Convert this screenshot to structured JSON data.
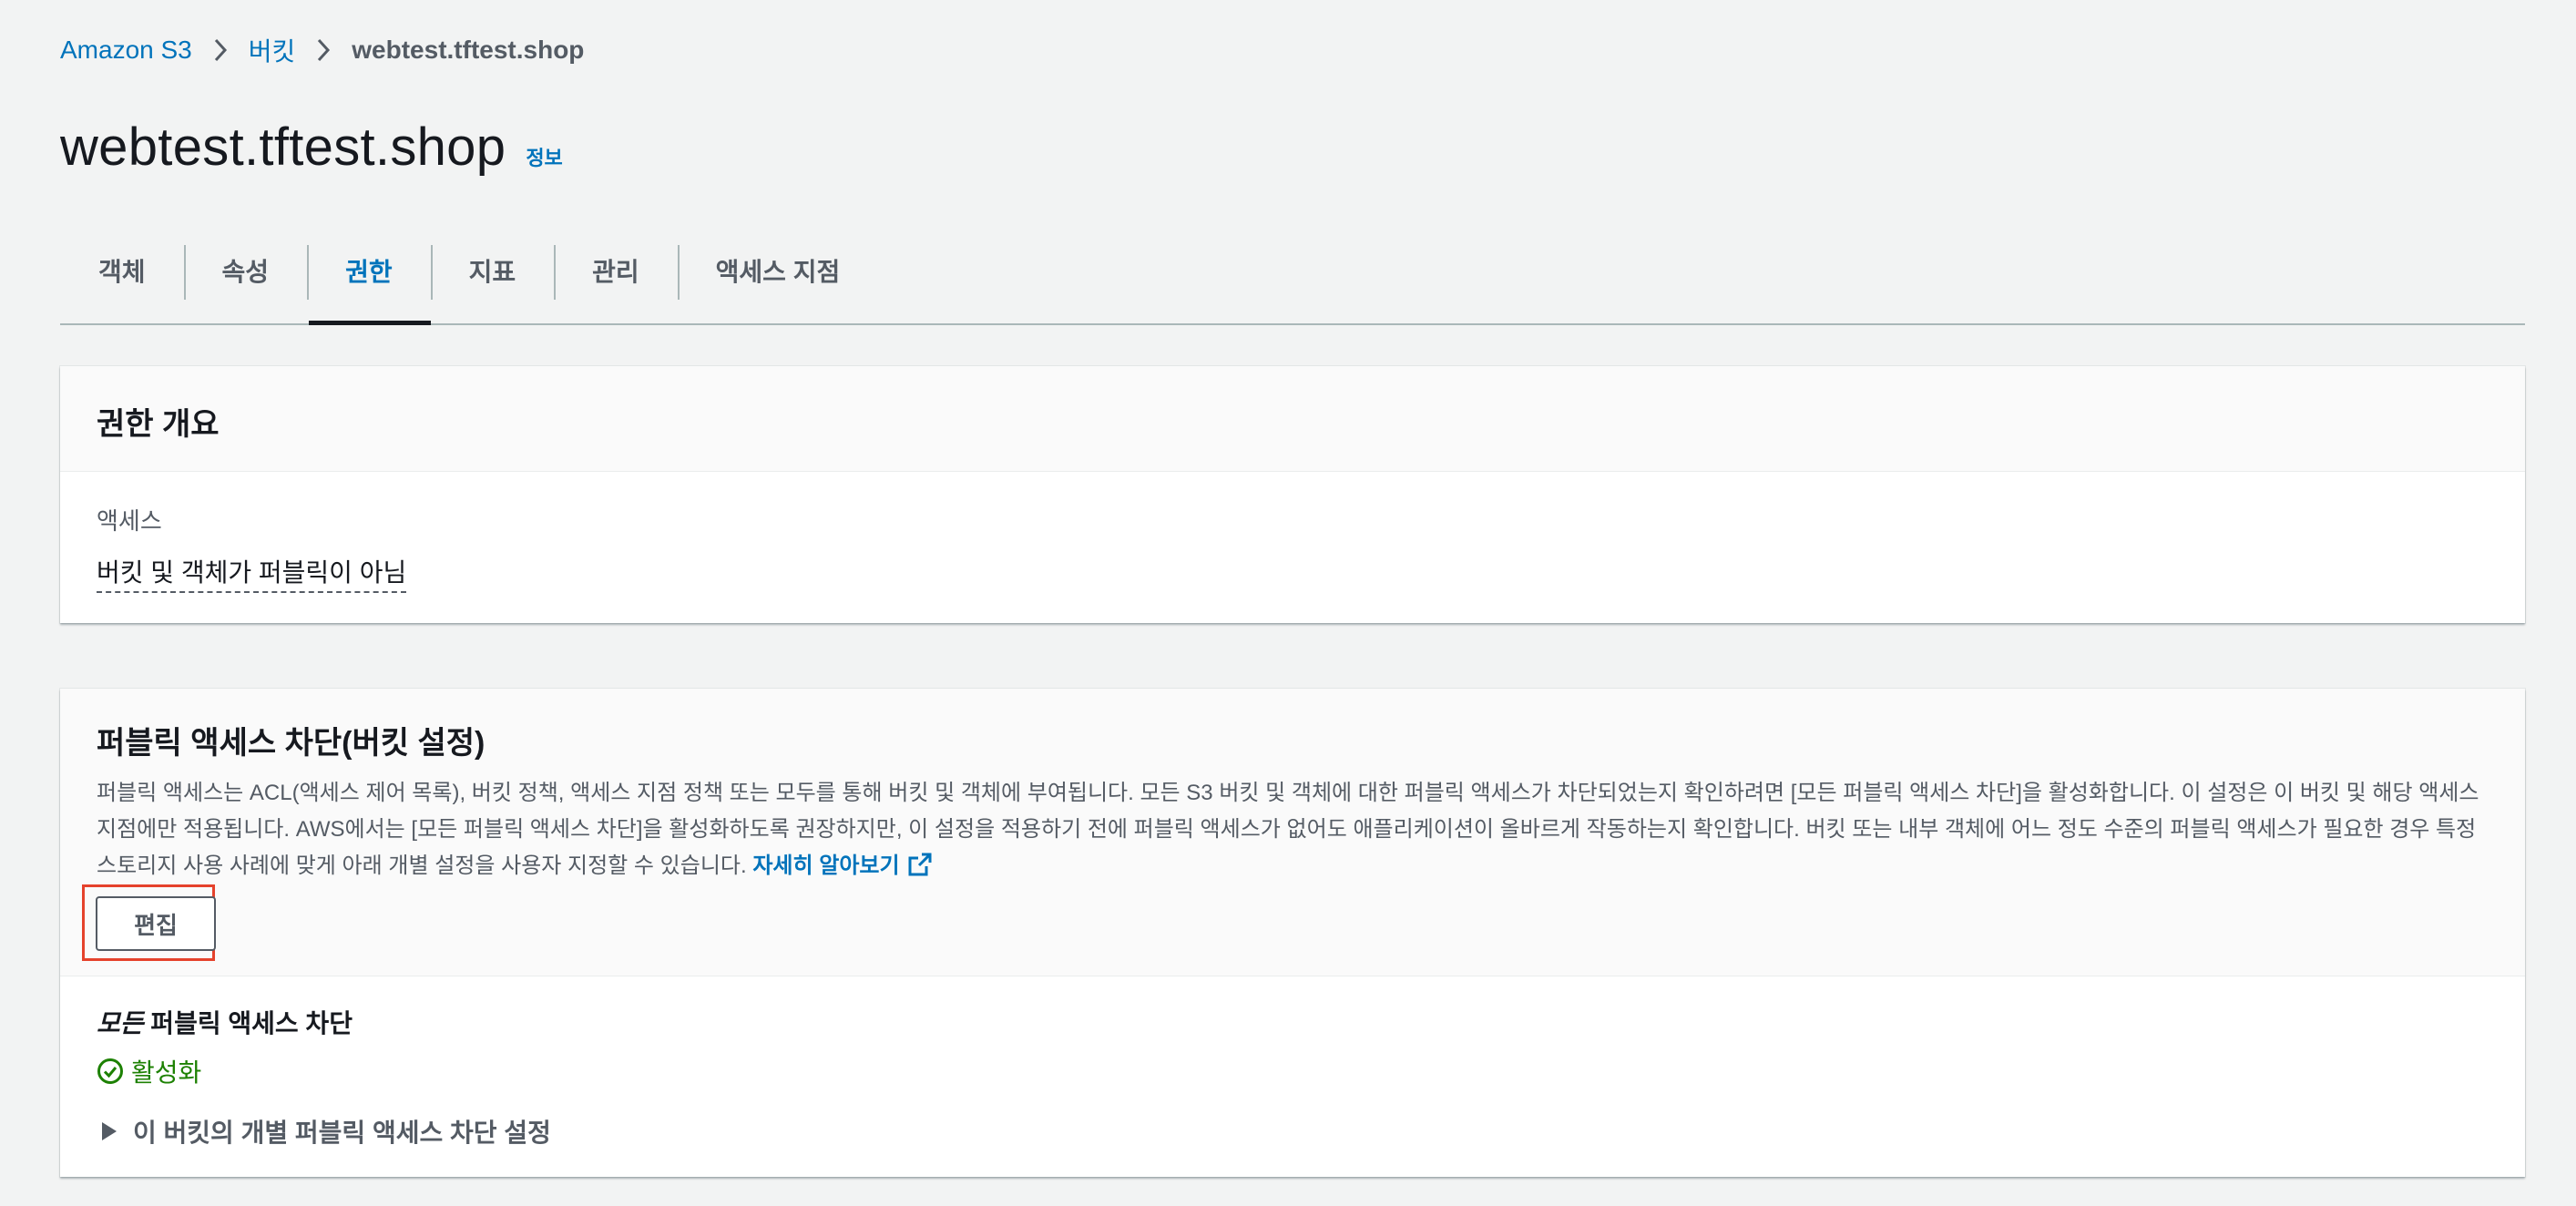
{
  "breadcrumb": {
    "items": [
      "Amazon S3",
      "버킷"
    ],
    "current": "webtest.tftest.shop"
  },
  "header": {
    "title": "webtest.tftest.shop",
    "info_label": "정보"
  },
  "tabs": [
    {
      "label": "객체"
    },
    {
      "label": "속성"
    },
    {
      "label": "권한",
      "active": true
    },
    {
      "label": "지표"
    },
    {
      "label": "관리"
    },
    {
      "label": "액세스 지점"
    }
  ],
  "overview": {
    "title": "권한 개요",
    "access_label": "액세스",
    "access_value": "버킷 및 객체가 퍼블릭이 아님"
  },
  "block_public_access": {
    "title": "퍼블릭 액세스 차단(버킷 설정)",
    "description": "퍼블릭 액세스는 ACL(액세스 제어 목록), 버킷 정책, 액세스 지점 정책 또는 모두를 통해 버킷 및 객체에 부여됩니다. 모든 S3 버킷 및 객체에 대한 퍼블릭 액세스가 차단되었는지 확인하려면 [모든 퍼블릭 액세스 차단]을 활성화합니다. 이 설정은 이 버킷 및 해당 액세스 지점에만 적용됩니다. AWS에서는 [모든 퍼블릭 액세스 차단]을 활성화하도록 권장하지만, 이 설정을 적용하기 전에 퍼블릭 액세스가 없어도 애플리케이션이 올바르게 작동하는지 확인합니다. 버킷 또는 내부 객체에 어느 정도 수준의 퍼블릭 액세스가 필요한 경우 특정 스토리지 사용 사례에 맞게 아래 개별 설정을 사용자 지정할 수 있습니다.",
    "learn_more": "자세히 알아보기",
    "edit_label": "편집",
    "all_label_em": "모든",
    "all_label_rest": " 퍼블릭 액세스 차단",
    "status": "활성화",
    "expander_label": "이 버킷의 개별 퍼블릭 액세스 차단 설정"
  },
  "colors": {
    "link": "#0073bb",
    "success": "#1d8102",
    "highlight": "#e5422c"
  }
}
